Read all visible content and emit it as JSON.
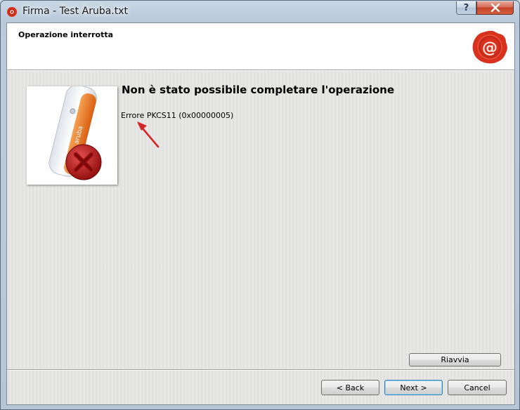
{
  "window": {
    "title": "Firma - Test Aruba.txt",
    "help_label": "?"
  },
  "header": {
    "title": "Operazione interrotta"
  },
  "main": {
    "heading": "Non è stato possibile completare l'operazione",
    "error_message": "Errore PKCS11 (0x00000005)"
  },
  "buttons": {
    "restart": "Riavvia",
    "back": "< Back",
    "next": "Next >",
    "cancel": "Cancel"
  },
  "colors": {
    "seal_red": "#d8321e",
    "token_orange": "#ee7a1a",
    "error_red": "#c01818",
    "arrow_red": "#d42525"
  },
  "icons": {
    "app": "wax-seal-icon",
    "header": "wax-seal-icon",
    "illustration": "usb-token-error-icon",
    "annotation": "arrow-icon"
  }
}
